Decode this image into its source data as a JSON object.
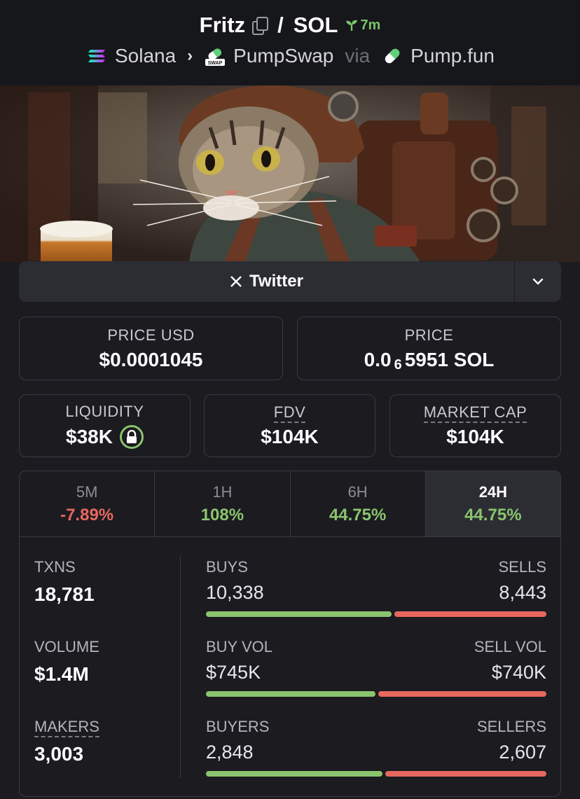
{
  "header": {
    "token": "Fritz",
    "quote": "SOL",
    "age": "7m",
    "chain": "Solana",
    "dex": "PumpSwap",
    "via": "via",
    "launchpad": "Pump.fun",
    "dex_logo_text": "SWAP"
  },
  "social": {
    "twitter_label": "Twitter"
  },
  "prices": {
    "price_usd_label": "PRICE USD",
    "price_usd": "$0.0001045",
    "price_label": "PRICE",
    "price_prefix": "0.0",
    "price_zeros": "6",
    "price_suffix": "5951 SOL"
  },
  "metrics": {
    "liquidity_label": "LIQUIDITY",
    "liquidity": "$38K",
    "fdv_label": "FDV",
    "fdv": "$104K",
    "mcap_label": "MARKET CAP",
    "mcap": "$104K"
  },
  "tabs": [
    {
      "label": "5M",
      "value": "-7.89%"
    },
    {
      "label": "1H",
      "value": "108%"
    },
    {
      "label": "6H",
      "value": "44.75%"
    },
    {
      "label": "24H",
      "value": "44.75%"
    }
  ],
  "stats": {
    "txns_label": "TXNS",
    "txns": "18,781",
    "volume_label": "VOLUME",
    "volume": "$1.4M",
    "makers_label": "MAKERS",
    "makers": "3,003",
    "buys_label": "BUYS",
    "buys": "10,338",
    "sells_label": "SELLS",
    "sells": "8,443",
    "buy_vol_label": "BUY VOL",
    "buy_vol": "$745K",
    "sell_vol_label": "SELL VOL",
    "sell_vol": "$740K",
    "buyers_label": "BUYERS",
    "buyers": "2,848",
    "sellers_label": "SELLERS",
    "sellers": "2,607",
    "buy_ratio_txns": 0.55,
    "buy_ratio_vol": 0.502,
    "buy_ratio_makers": 0.522
  },
  "colors": {
    "positive": "#8bc46e",
    "negative": "#e8675f",
    "background": "#1b1b20"
  }
}
